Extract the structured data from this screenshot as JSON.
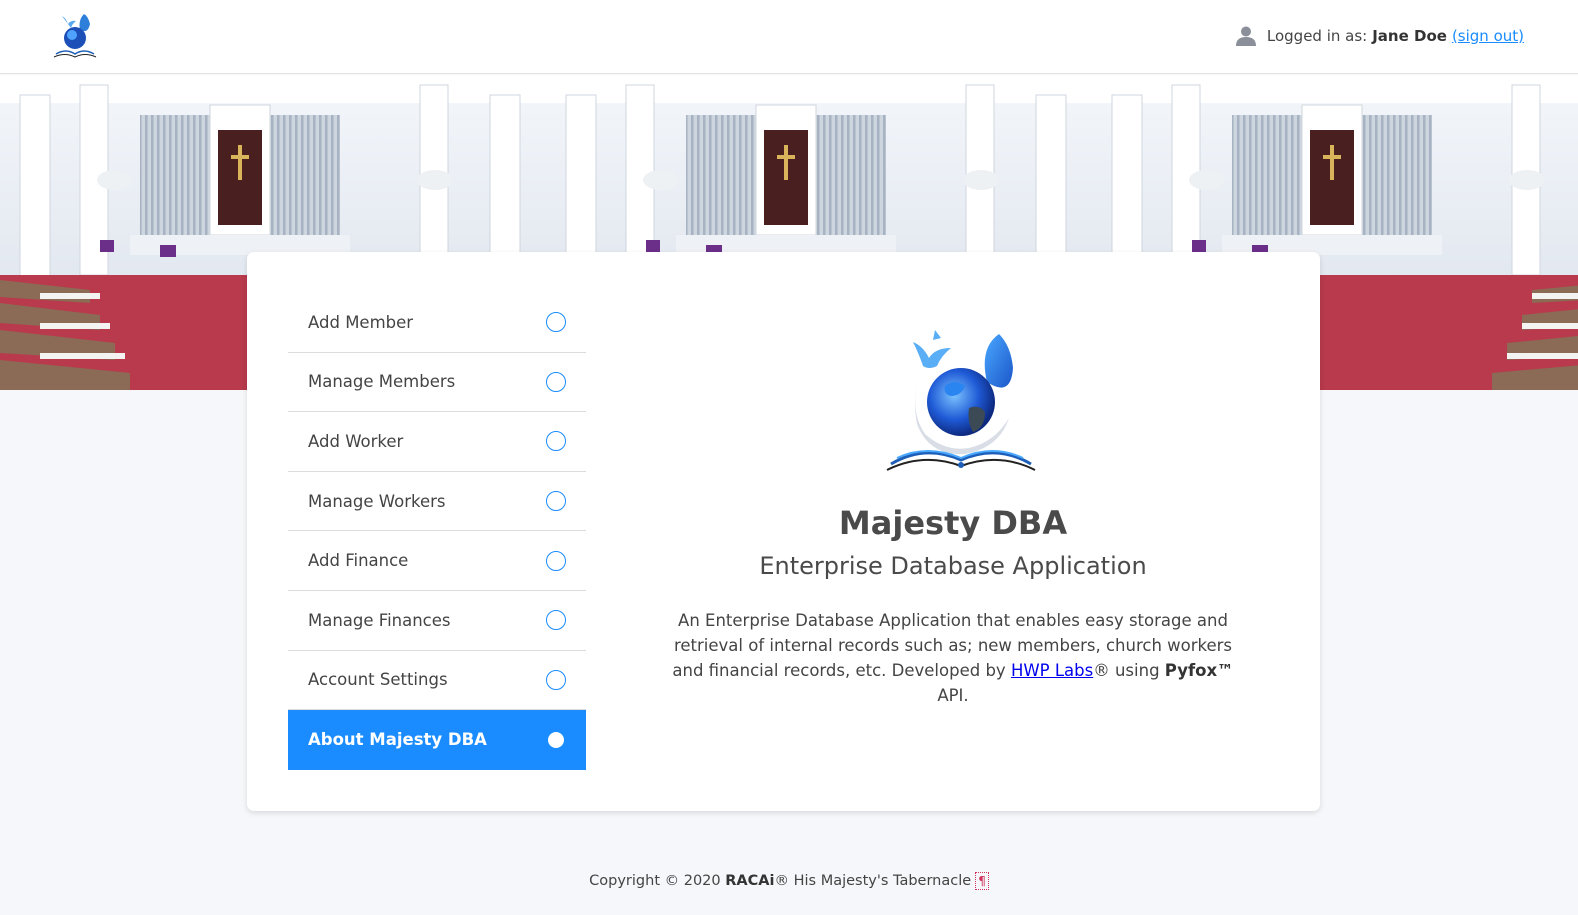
{
  "header": {
    "logo_icon": "majesty-dove-globe-logo",
    "logged_in_label": "Logged in as:",
    "user_name": "Jane Doe",
    "sign_out_label": "(sign out)"
  },
  "menu": {
    "items": [
      {
        "label": "Add Member",
        "active": false
      },
      {
        "label": "Manage Members",
        "active": false
      },
      {
        "label": "Add Worker",
        "active": false
      },
      {
        "label": "Manage Workers",
        "active": false
      },
      {
        "label": "Add Finance",
        "active": false
      },
      {
        "label": "Manage Finances",
        "active": false
      },
      {
        "label": "Account Settings",
        "active": false
      },
      {
        "label": "About Majesty DBA",
        "active": true
      }
    ]
  },
  "about": {
    "title": "Majesty DBA",
    "subtitle": "Enterprise Database Application",
    "desc_part1": "An Enterprise Database Application that enables easy storage and retrieval of internal records such as; new members, church workers and financial records, etc. Developed by ",
    "desc_link": "HWP Labs",
    "desc_part2": "® using ",
    "desc_bold": "Pyfox™",
    "desc_part3": " API."
  },
  "footer": {
    "prefix": "Copyright © 2020 ",
    "brand": "RACAi",
    "suffix": "® His Majesty's Tabernacle",
    "mark": "¶"
  },
  "colors": {
    "accent": "#1a8cff",
    "background": "#f6f7fa"
  }
}
